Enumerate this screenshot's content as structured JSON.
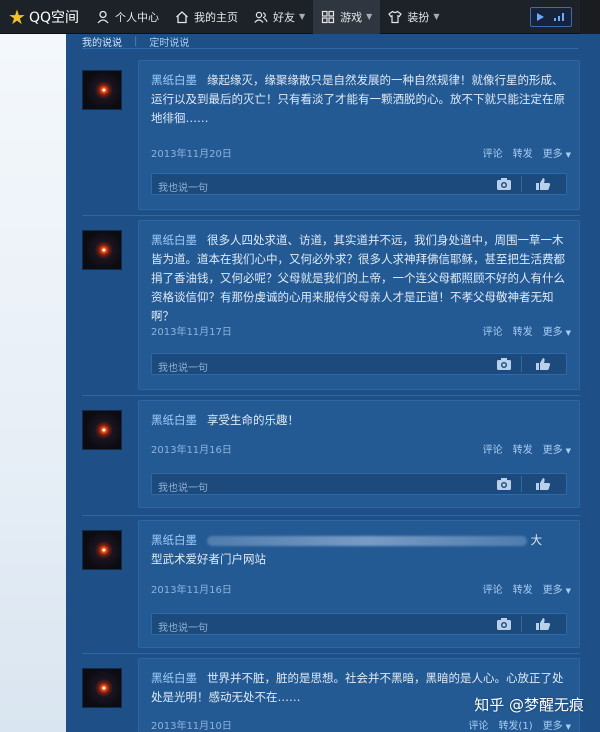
{
  "topbar": {
    "logo_text": "QQ空间",
    "nav": [
      {
        "label": "个人中心",
        "icon": "person-icon"
      },
      {
        "label": "我的主页",
        "icon": "home-icon"
      },
      {
        "label": "好友",
        "icon": "friends-icon"
      },
      {
        "label": "游戏",
        "icon": "grid-icon"
      },
      {
        "label": "装扮",
        "icon": "shirt-icon"
      }
    ],
    "active_nav": "游戏",
    "colors": {
      "bar": "#1d2128",
      "accent": "#f3c22d"
    }
  },
  "subnav": {
    "tab1": "我的说说",
    "separator": "|",
    "tab2": "定时说说"
  },
  "posts": [
    {
      "author": "黑纸白墨",
      "text": "缘起缘灭，缘聚缘散只是自然发展的一种自然规律！就像行星的形成、运行以及到最后的灭亡！只有看淡了才能有一颗洒脱的心。放不下就只能注定在原地徘徊……",
      "date": "2013年11月20日",
      "comment": "评论",
      "forward": "转发",
      "more": "更多",
      "reply_placeholder": "我也说一句"
    },
    {
      "author": "黑纸白墨",
      "text": "很多人四处求道、访道，其实道并不远，我们身处道中，周围一草一木皆为道。道本在我们心中，又何必外求？很多人求神拜佛信耶稣，甚至把生活费都捐了香油钱，又何必呢？父母就是我们的上帝，一个连父母都照顾不好的人有什么资格谈信仰？有那份虔诚的心用来服侍父母亲人才是正道！不孝父母敬神者无知啊？",
      "date": "2013年11月17日",
      "comment": "评论",
      "forward": "转发",
      "more": "更多",
      "reply_placeholder": "我也说一句"
    },
    {
      "author": "黑纸白墨",
      "text": "享受生命的乐趣！",
      "date": "2013年11月16日",
      "comment": "评论",
      "forward": "转发",
      "more": "更多",
      "reply_placeholder": "我也说一句"
    },
    {
      "author": "黑纸白墨",
      "text_tail": "大",
      "text_line2": "型武术爱好者门户网站",
      "date": "2013年11月16日",
      "comment": "评论",
      "forward": "转发",
      "more": "更多",
      "reply_placeholder": "我也说一句"
    },
    {
      "author": "黑纸白墨",
      "text": "世界并不脏，脏的是思想。社会并不黑暗，黑暗的是人心。心放正了处处是光明！感动无处不在……",
      "date": "2013年11月10日",
      "comment": "评论",
      "forward": "转发(1)",
      "more": "更多"
    }
  ],
  "watermark": "知乎 @梦醒无痕"
}
